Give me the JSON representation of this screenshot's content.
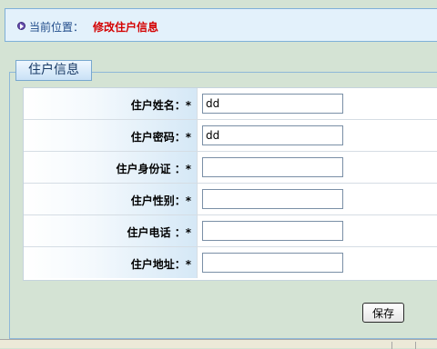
{
  "breadcrumb": {
    "prefix": "当前位置：",
    "current": "修改住户信息"
  },
  "form": {
    "legend": "住户信息",
    "fields": [
      {
        "label": "住户姓名：*",
        "value": "dd"
      },
      {
        "label": "住户密码：*",
        "value": "dd"
      },
      {
        "label": "住户身份证 ：*",
        "value": ""
      },
      {
        "label": "住户性别：*",
        "value": ""
      },
      {
        "label": "住户电话 ：*",
        "value": ""
      },
      {
        "label": "住户地址：*",
        "value": ""
      }
    ],
    "save_label": "保存"
  }
}
